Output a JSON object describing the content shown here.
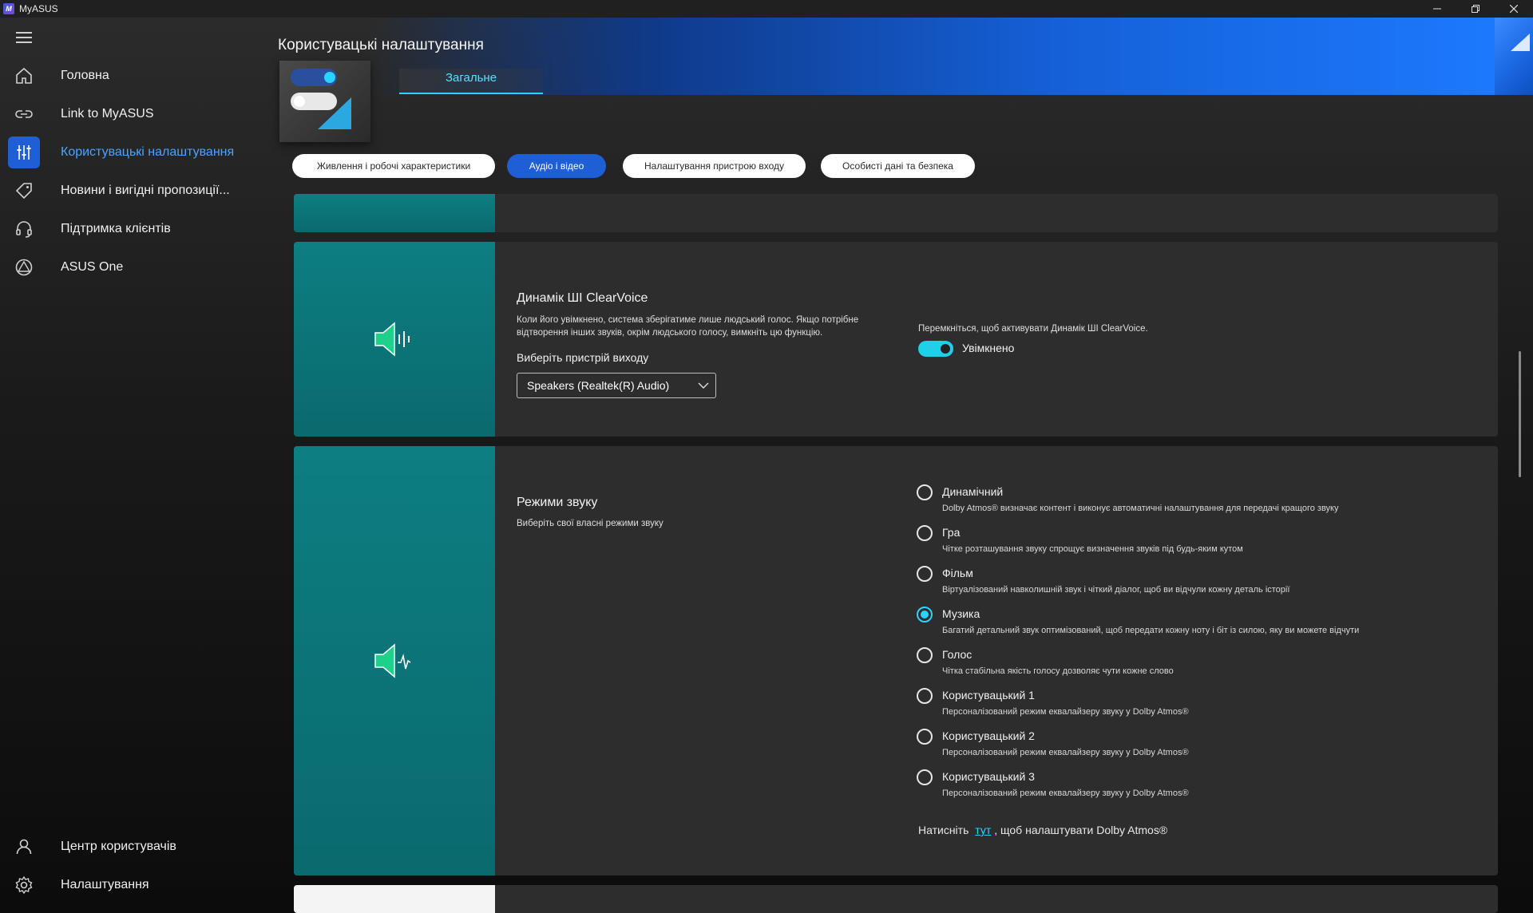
{
  "window": {
    "title": "MyASUS",
    "logo_text": "M"
  },
  "sidebar": {
    "items": [
      {
        "label": "Головна",
        "icon": "home-icon"
      },
      {
        "label": "Link to MyASUS",
        "icon": "link-icon"
      },
      {
        "label": "Користувацькі налаштування",
        "icon": "sliders-icon",
        "active": true
      },
      {
        "label": "Новини і вигідні пропозиції...",
        "icon": "tag-icon"
      },
      {
        "label": "Підтримка клієнтів",
        "icon": "headset-icon"
      },
      {
        "label": "ASUS One",
        "icon": "asus-one-icon"
      }
    ],
    "bottom_items": [
      {
        "label": "Центр користувачів",
        "icon": "user-icon"
      },
      {
        "label": "Налаштування",
        "icon": "gear-icon"
      }
    ]
  },
  "header": {
    "title": "Користувацькі налаштування",
    "tab": "Загальне"
  },
  "pills": [
    {
      "label": "Живлення і робочі характеристики",
      "active": false
    },
    {
      "label": "Аудіо і відео",
      "active": true
    },
    {
      "label": "Налаштування пристрою входу",
      "active": false
    },
    {
      "label": "Особисті дані та безпека",
      "active": false
    }
  ],
  "clearvoice": {
    "title": "Динамік ШІ ClearVoice",
    "desc_line1": "Коли його увімкнено, система зберігатиме лише людський голос. Якщо потрібне",
    "desc_line2": "відтворення інших звуків, окрім людського голосу, вимкніть цю функцію.",
    "output_label": "Виберіть пристрій виходу",
    "output_value": "Speakers (Realtek(R) Audio)",
    "toggle_hint": "Перемкніться, щоб активувати Динамік ШІ ClearVoice.",
    "toggle_state": "Увімкнено",
    "toggle_on": true
  },
  "sound_modes": {
    "title": "Режими звуку",
    "desc": "Виберіть свої власні режими звуку",
    "options": [
      {
        "label": "Динамічний",
        "desc": "Dolby Atmos® визначає контент і виконує автоматичні налаштування для передачі кращого звуку",
        "checked": false
      },
      {
        "label": "Гра",
        "desc": "Чітке розташування звуку спрощує визначення звуків під будь-яким кутом",
        "checked": false
      },
      {
        "label": "Фільм",
        "desc": "Віртуалізований навколишній звук і чіткий діалог, щоб ви відчули кожну деталь історії",
        "checked": false
      },
      {
        "label": "Музика",
        "desc": "Багатий детальний звук оптимізований, щоб передати кожну ноту і біт із силою, яку ви можете відчути",
        "checked": true
      },
      {
        "label": "Голос",
        "desc": "Чітка стабільна якість голосу дозволяє чути кожне слово",
        "checked": false
      },
      {
        "label": "Користувацький 1",
        "desc": "Персоналізований режим еквалайзеру звуку у Dolby Atmos®",
        "checked": false
      },
      {
        "label": "Користувацький 2",
        "desc": "Персоналізований режим еквалайзеру звуку у Dolby Atmos®",
        "checked": false
      },
      {
        "label": "Користувацький 3",
        "desc": "Персоналізований режим еквалайзеру звуку у Dolby Atmos®",
        "checked": false
      }
    ],
    "footer_prefix": "Натисніть",
    "footer_link": "тут",
    "footer_suffix": ", щоб налаштувати Dolby Atmos®"
  },
  "colors": {
    "accent_blue": "#1f5fd6",
    "accent_cyan": "#2ad3ff",
    "teal_panel": "#0d7e82",
    "speaker_green": "#1fd08a"
  }
}
